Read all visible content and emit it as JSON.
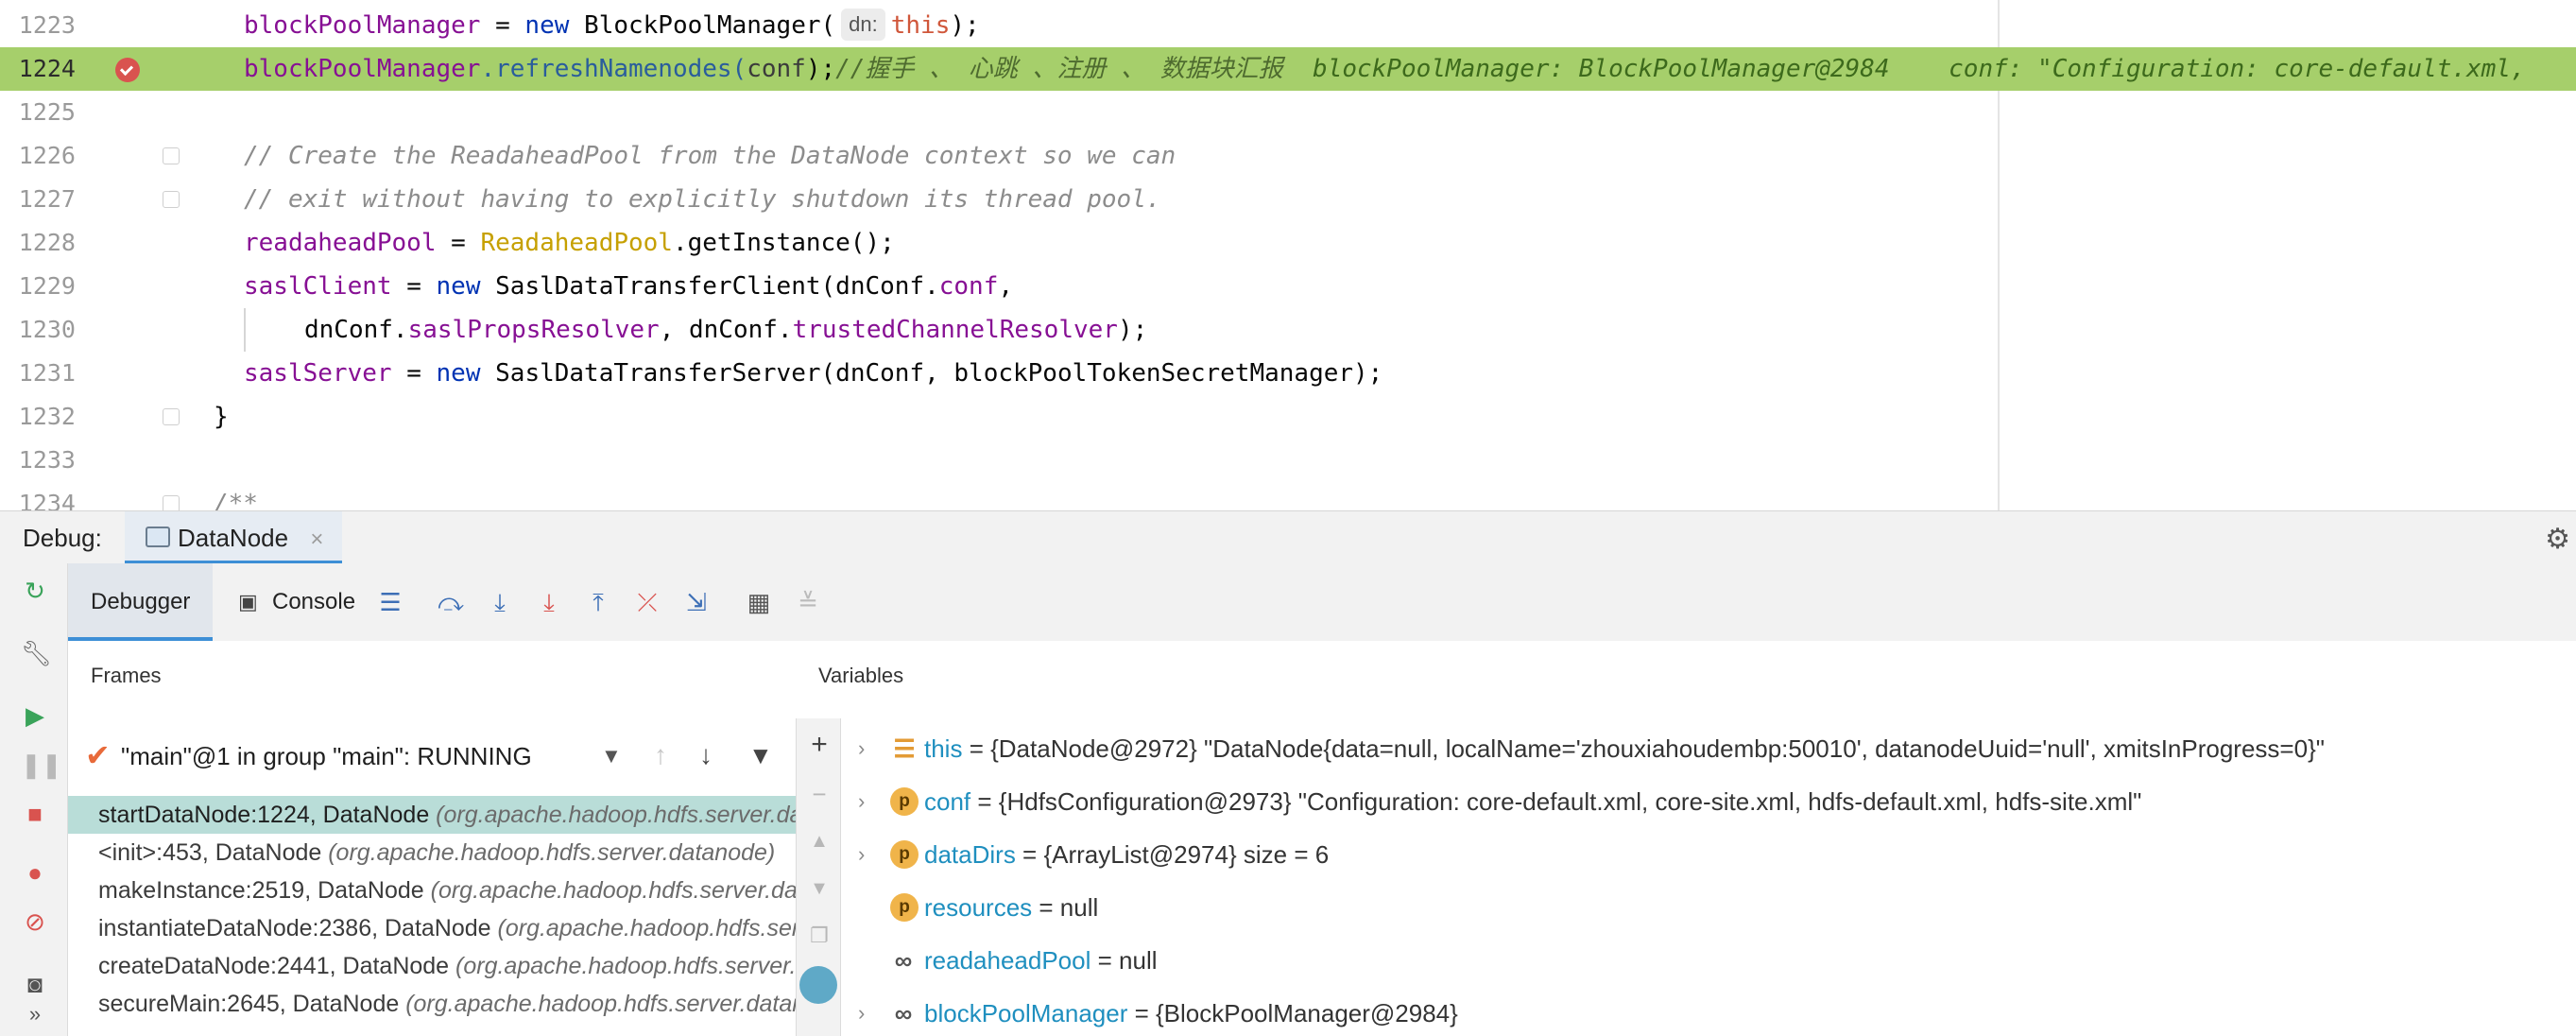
{
  "editor": {
    "lines": [
      {
        "num": "1223"
      },
      {
        "num": "1224"
      },
      {
        "num": "1225"
      },
      {
        "num": "1226"
      },
      {
        "num": "1227"
      },
      {
        "num": "1228"
      },
      {
        "num": "1229"
      },
      {
        "num": "1230"
      },
      {
        "num": "1231"
      },
      {
        "num": "1232"
      },
      {
        "num": "1233"
      },
      {
        "num": "1234"
      }
    ],
    "l1223": {
      "var": "blockPoolManager",
      "op": " = ",
      "kw": "new",
      "cls": " BlockPoolManager(",
      "hint": "dn:",
      "this": "this",
      "end": ");"
    },
    "l1224": {
      "var": "blockPoolManager",
      "method": ".refreshNamenodes(",
      "arg": "conf",
      "end": ");",
      "comment": "//握手 、 心跳 、注册 、 数据块汇报",
      "inline": "  blockPoolManager: BlockPoolManager@2984    conf: \"Configuration: core-default.xml, "
    },
    "l1226": "// Create the ReadaheadPool from the DataNode context so we can",
    "l1227": "// exit without having to explicitly shutdown its thread pool.",
    "l1228": {
      "var": "readaheadPool",
      "op": " = ",
      "cls": "ReadaheadPool",
      "rest": ".getInstance();"
    },
    "l1229": {
      "var": "saslClient",
      "op": " = ",
      "kw": "new",
      "cls": " SaslDataTransferClient(dnConf.",
      "fld": "conf",
      "end": ","
    },
    "l1230": {
      "a": "dnConf.",
      "f1": "saslPropsResolver",
      "b": ", dnConf.",
      "f2": "trustedChannelResolver",
      "end": ");"
    },
    "l1231": {
      "var": "saslServer",
      "op": " = ",
      "kw": "new",
      "rest": " SaslDataTransferServer(dnConf, blockPoolTokenSecretManager);"
    },
    "l1232": "}",
    "l1234": "/**"
  },
  "debug": {
    "label": "Debug:",
    "tab": "DataNode",
    "close": "×",
    "tabs": {
      "debugger": "Debugger",
      "console": "Console"
    },
    "frames_title": "Frames",
    "variables_title": "Variables",
    "thread": "\"main\"@1 in group \"main\": RUNNING",
    "frames": [
      {
        "method": "startDataNode:1224, DataNode ",
        "pkg": "(org.apache.hadoop.hdfs.server.datanode)"
      },
      {
        "method": "<init>:453, DataNode ",
        "pkg": "(org.apache.hadoop.hdfs.server.datanode)"
      },
      {
        "method": "makeInstance:2519, DataNode ",
        "pkg": "(org.apache.hadoop.hdfs.server.datanode)"
      },
      {
        "method": "instantiateDataNode:2386, DataNode ",
        "pkg": "(org.apache.hadoop.hdfs.server.datanode)"
      },
      {
        "method": "createDataNode:2441, DataNode ",
        "pkg": "(org.apache.hadoop.hdfs.server.datanode)"
      },
      {
        "method": "secureMain:2645, DataNode ",
        "pkg": "(org.apache.hadoop.hdfs.server.datanode)"
      }
    ],
    "variables": [
      {
        "name": "this",
        "value": " = {DataNode@2972} \"DataNode{data=null, localName='zhouxiahoudembp:50010', datanodeUuid='null', xmitsInProgress=0}\""
      },
      {
        "name": "conf",
        "value": " = {HdfsConfiguration@2973} \"Configuration: core-default.xml, core-site.xml, hdfs-default.xml, hdfs-site.xml\""
      },
      {
        "name": "dataDirs",
        "value": " = {ArrayList@2974}  size = 6"
      },
      {
        "name": "resources",
        "value": " = null"
      },
      {
        "name": "readaheadPool",
        "value": " = null"
      },
      {
        "name": "blockPoolManager",
        "value": " = {BlockPoolManager@2984}"
      }
    ]
  }
}
